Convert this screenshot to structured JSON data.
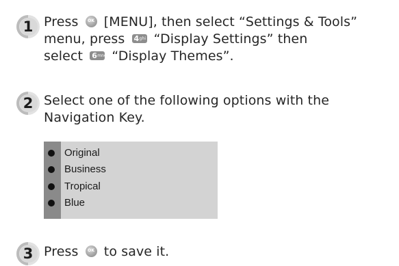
{
  "steps": [
    {
      "number": "1",
      "line1_a": "Press",
      "line1_b": "[MENU], then select “Settings & Tools”",
      "line2_a": "menu, press",
      "line2_b": "“Display Settings” then",
      "line3_a": "select",
      "line3_b": "“Display Themes”."
    },
    {
      "number": "2",
      "line1": "Select one of the following options with the",
      "line2": "Navigation Key."
    },
    {
      "number": "3",
      "line1_a": "Press",
      "line1_b": "to save it."
    }
  ],
  "keys": {
    "ok": "OK",
    "key4_digit": "4",
    "key4_letters": "ghi",
    "key6_digit": "6",
    "key6_letters": "mno"
  },
  "options": [
    "Original",
    "Business",
    "Tropical",
    "Blue"
  ],
  "icons": {
    "step_badge": "step-number-badge-icon",
    "ok_key": "ok-key-icon",
    "num_key": "number-key-icon",
    "bullet": "bullet-icon"
  }
}
